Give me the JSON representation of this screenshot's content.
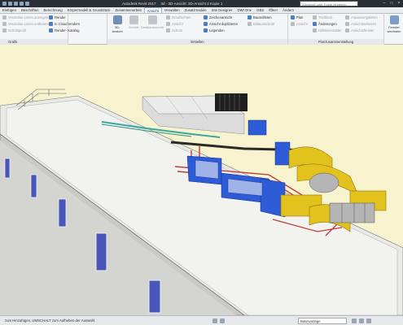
{
  "titlebar": {
    "app": "Autodesk Revit 2017",
    "document": "3d - 3D-Ansicht: 3D-Ansicht 2 Kopie 1",
    "search_placeholder": "Stichwort oder Frage eingeben"
  },
  "tabs": [
    "Einfügen",
    "Beschriften",
    "Berechnung",
    "Körpermodell & Grundstück",
    "Zusammenarbeit",
    "Ansicht",
    "Verwalten",
    "Zusatzmodule",
    "Site Designer",
    "DWI One",
    "GBS",
    "Ifftner",
    "Ändern"
  ],
  "active_tab": "Ansicht",
  "ribbon": {
    "grafik": {
      "items": [
        "Verdeckte Linien anzeigen",
        "Verdeckte Linien entfernen",
        "Schnittprofil"
      ],
      "render_items": [
        "Render",
        "In Cloud rendern",
        "Render- Katalog"
      ],
      "label": "Grafik"
    },
    "erstellen": {
      "big": [
        "3D- Ansicht",
        "Schnitt",
        "Detailausschnitt"
      ],
      "mid": [
        "Draufsichten",
        "Ansicht",
        "Schnitt"
      ],
      "right": [
        "Zeichenansicht",
        "Ansicht duplizieren",
        "Legenden"
      ],
      "far": [
        "Bauteillisten",
        "Bildausschnitt",
        "Schnitt"
      ],
      "label": "Erstellen"
    },
    "plan": {
      "items": [
        "Plan",
        "Titelblock",
        "Ansicht",
        "Planliste",
        "Revisionen",
        "Änderungen",
        "Hilfslinienraster",
        "Ansichtsfenster",
        "Anpassungslinien",
        "Ansichtsreferenz"
      ],
      "label": "Planzusammenstellung"
    },
    "fenster": {
      "label": "Fenster wechseln"
    }
  },
  "status": {
    "message": "zum Hinzufügen, UMSCHALT zum Aufheben der Auswahl.",
    "model": "Basisvorlage",
    "scale": "0"
  },
  "colors": {
    "viewport_bg": "#f7f3cf",
    "duct_blue": "#2e5bd6",
    "duct_yellow": "#e3c21d",
    "pipe_red": "#c23a3a"
  }
}
